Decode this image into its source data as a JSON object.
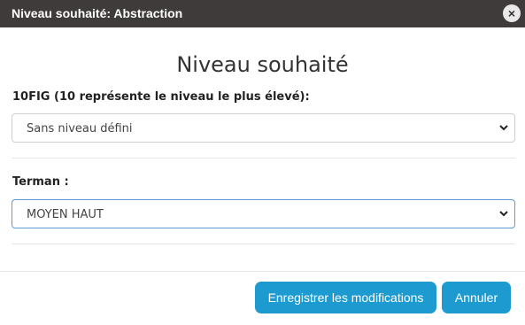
{
  "dialog": {
    "title": "Niveau souhaité: Abstraction",
    "heading": "Niveau souhaité",
    "close_icon": "close-icon"
  },
  "fields": [
    {
      "label": "10FIG (10 représente le niveau le plus élevé):",
      "value": "Sans niveau défini"
    },
    {
      "label": "Terman :",
      "value": "MOYEN HAUT"
    }
  ],
  "buttons": {
    "save": "Enregistrer les modifications",
    "cancel": "Annuler"
  },
  "colors": {
    "titlebar": "#3f3b3a",
    "button": "#1d9bd1",
    "focus_border": "#5a9bd6"
  }
}
